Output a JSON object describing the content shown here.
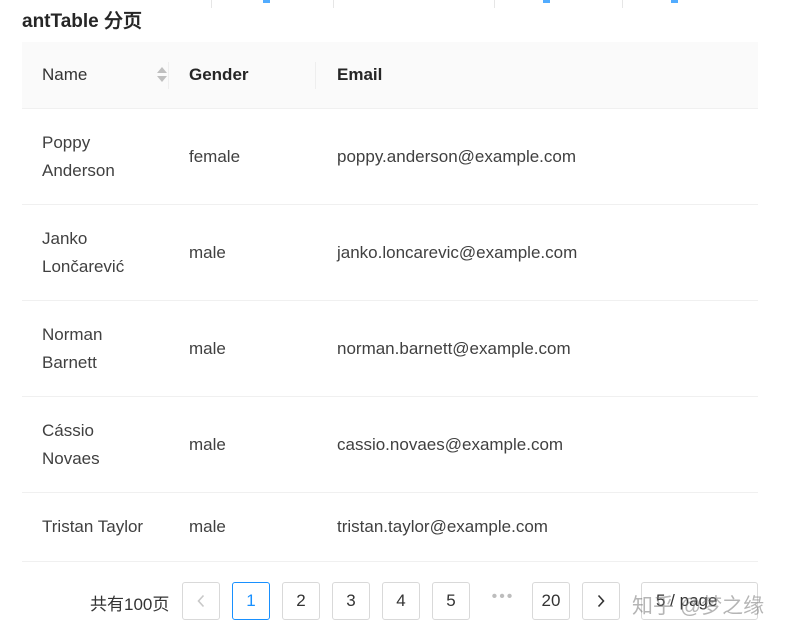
{
  "title": "antTable 分页",
  "table": {
    "columns": [
      {
        "label": "Name",
        "sortable": true
      },
      {
        "label": "Gender"
      },
      {
        "label": "Email"
      }
    ],
    "rows": [
      {
        "name": "Poppy Anderson",
        "gender": "female",
        "email": "poppy.anderson@example.com"
      },
      {
        "name": "Janko Lončarević",
        "gender": "male",
        "email": "janko.loncarevic@example.com"
      },
      {
        "name": "Norman Barnett",
        "gender": "male",
        "email": "norman.barnett@example.com"
      },
      {
        "name": "Cássio Novaes",
        "gender": "male",
        "email": "cassio.novaes@example.com"
      },
      {
        "name": "Tristan Taylor",
        "gender": "male",
        "email": "tristan.taylor@example.com"
      }
    ]
  },
  "pagination": {
    "total_text": "共有100页",
    "pages": [
      "1",
      "2",
      "3",
      "4",
      "5"
    ],
    "current": "1",
    "ellipsis": "•••",
    "last_page": "20",
    "size_changer": "5 / page"
  },
  "watermark": "知乎 @梦之缘",
  "colors": {
    "accent": "#1890ff",
    "header_bg": "#fafafa",
    "border": "#f0f0f0"
  },
  "icons": {
    "prev": "chevron-left-icon",
    "next": "chevron-right-icon",
    "sort": "sort-caret-icon"
  }
}
